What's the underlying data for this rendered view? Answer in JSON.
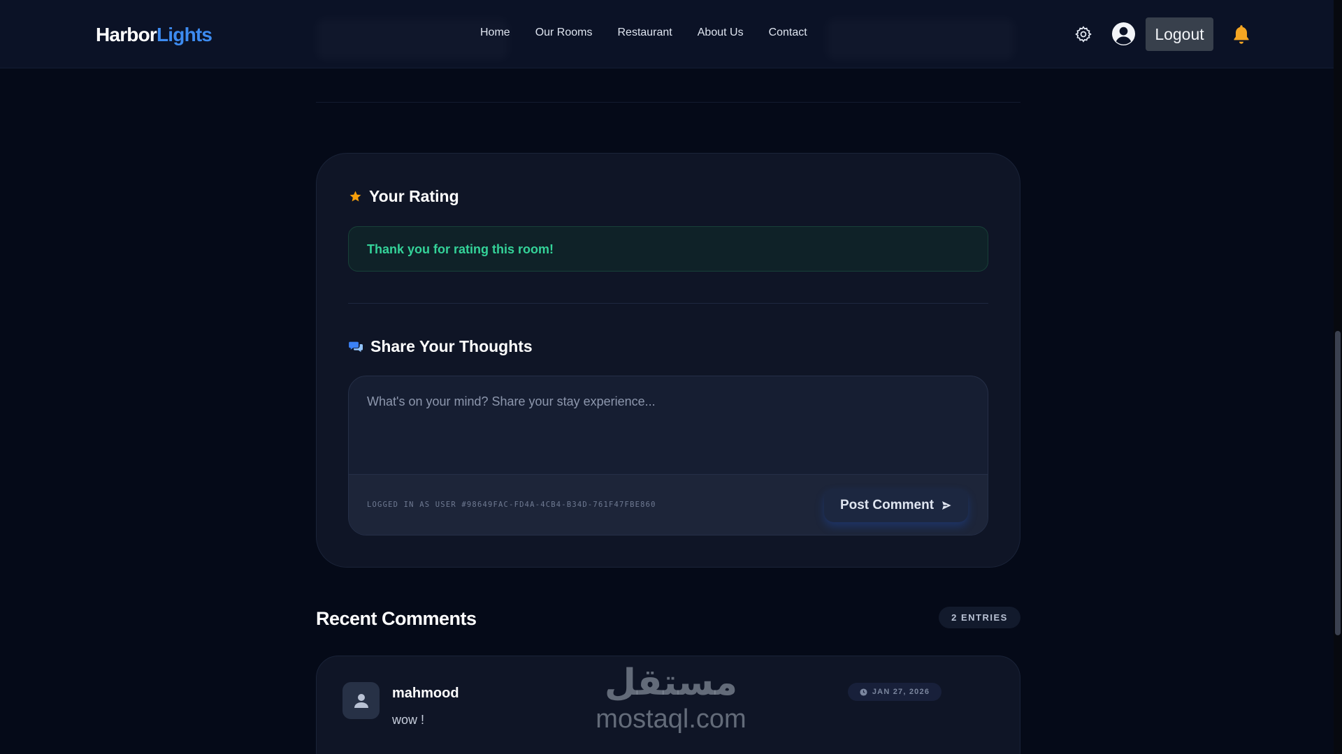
{
  "brand": {
    "name_part1": "Harbor",
    "name_part2": "Lights",
    "accent": "#3d8bf0"
  },
  "nav": {
    "links": [
      "Home",
      "Our Rooms",
      "Restaurant",
      "About Us",
      "Contact"
    ],
    "logout_label": "Logout",
    "icons": [
      "gear-icon",
      "user-circle-icon",
      "bell-icon"
    ],
    "bell_color": "#f5a623"
  },
  "rating": {
    "title": "Your Rating",
    "icon": "star-icon",
    "success_message": "Thank you for rating this room!",
    "success_color": "#34d399"
  },
  "thoughts": {
    "title": "Share Your Thoughts",
    "icon": "chat-bubbles-icon",
    "placeholder": "What's on your mind? Share your stay experience...",
    "value": "",
    "logged_in_text": "LOGGED IN AS USER #98649FAC-FD4A-4CB4-B34D-761F47FBE860",
    "post_label": "Post Comment"
  },
  "recent": {
    "title": "Recent Comments",
    "count_label": "2 ENTRIES",
    "comments": [
      {
        "author": "mahmood",
        "text": "wow !",
        "date": "JAN 27, 2026"
      }
    ]
  },
  "watermark": {
    "arabic": "مستقل",
    "latin": "mostaql.com"
  }
}
